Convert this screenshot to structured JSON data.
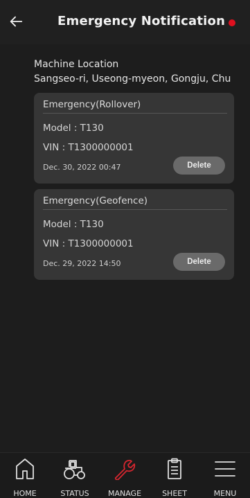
{
  "header": {
    "title": "Emergency Notification",
    "back_icon": "arrow-left-icon",
    "status_dot_color": "#e0101f"
  },
  "location": {
    "label": "Machine Location",
    "value": "Sangseo-ri, Useong-myeon, Gongju, Chu"
  },
  "notifications": [
    {
      "title": "Emergency(Rollover)",
      "model": "Model : T130",
      "vin": "VIN : T1300000001",
      "date": "Dec. 30, 2022 00:47",
      "delete_label": "Delete"
    },
    {
      "title": "Emergency(Geofence)",
      "model": "Model : T130",
      "vin": "VIN : T1300000001",
      "date": "Dec. 29, 2022 14:50",
      "delete_label": "Delete"
    }
  ],
  "nav": {
    "items": [
      {
        "label": "HOME",
        "icon": "home-icon",
        "active": false
      },
      {
        "label": "STATUS",
        "icon": "tractor-icon",
        "active": false
      },
      {
        "label": "MANAGE",
        "icon": "wrench-icon",
        "active": true
      },
      {
        "label": "SHEET",
        "icon": "clipboard-icon",
        "active": false
      },
      {
        "label": "MENU",
        "icon": "hamburger-menu-icon",
        "active": false
      }
    ],
    "active_color": "#d8262f",
    "inactive_color": "#e0e0e0"
  }
}
